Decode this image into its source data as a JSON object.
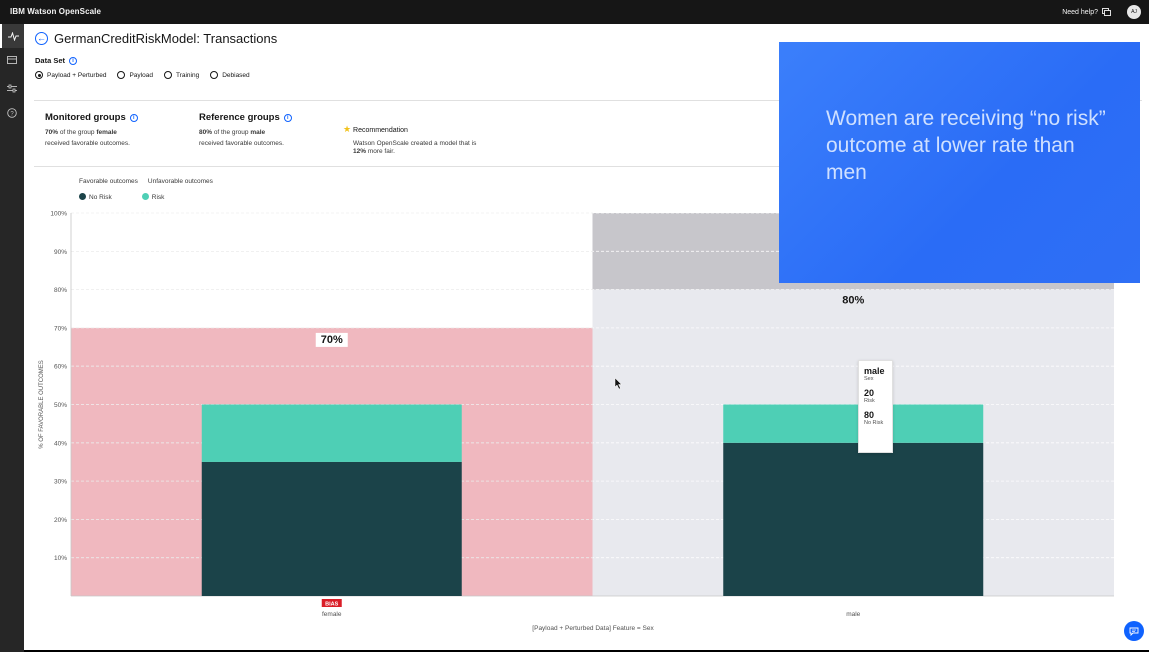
{
  "topbar": {
    "brand_bold": "IBM",
    "brand_rest": " Watson OpenScale",
    "help": "Need help?",
    "avatar": "AJ"
  },
  "page": {
    "title": "GermanCreditRiskModel: Transactions"
  },
  "dataset": {
    "label": "Data Set",
    "options": [
      {
        "label": "Payload + Perturbed",
        "selected": true
      },
      {
        "label": "Payload",
        "selected": false
      },
      {
        "label": "Training",
        "selected": false
      },
      {
        "label": "Debiased",
        "selected": false
      }
    ]
  },
  "monitored": {
    "title": "Monitored groups",
    "pct": "70%",
    "mid": " of the group ",
    "group": "female",
    "rest": "received favorable outcomes."
  },
  "reference": {
    "title": "Reference groups",
    "pct": "80%",
    "mid": " of the group ",
    "group": "male",
    "rest": "received favorable outcomes."
  },
  "recommendation": {
    "label": "Recommendation",
    "line1": "Watson OpenScale created a model that is",
    "pct": "12%",
    "line2": " more fair."
  },
  "legend": {
    "favorable": "Favorable outcomes",
    "unfavorable": "Unfavorable outcomes",
    "no_risk": "No Risk",
    "risk": "Risk",
    "no_risk_color": "#1b4349",
    "risk_color": "#4ecfb5"
  },
  "chart_data": {
    "type": "bar",
    "ylabel": "% OF FAVORABLE OUTCOMES",
    "xlabel": "[Payload + Perturbed Data] Feature = Sex",
    "ylim": [
      0,
      100
    ],
    "yticks": [
      "10%",
      "20%",
      "30%",
      "40%",
      "50%",
      "60%",
      "70%",
      "80%",
      "90%",
      "100%"
    ],
    "categories": [
      "female",
      "male"
    ],
    "favorable_pct": [
      70,
      80
    ],
    "favorable_labels": [
      "70%",
      "80%"
    ],
    "series": [
      {
        "name": "No Risk",
        "values": [
          35,
          40
        ]
      },
      {
        "name": "Risk",
        "values": [
          15,
          10
        ]
      }
    ],
    "bias_badge": "BIAS",
    "colors": {
      "female_band": "#f0b8bf",
      "male_band": "#e8e9ee",
      "male_top": "#c7c6cb",
      "no_risk": "#1b4349",
      "risk": "#4ecfb5"
    }
  },
  "tooltip": {
    "group": "male",
    "feature": "Sex",
    "risk_val": "20",
    "risk_label": "Risk",
    "norisk_val": "80",
    "norisk_label": "No Risk"
  },
  "overlay": {
    "text": "Women are receiving “no risk” outcome at lower rate than men"
  }
}
